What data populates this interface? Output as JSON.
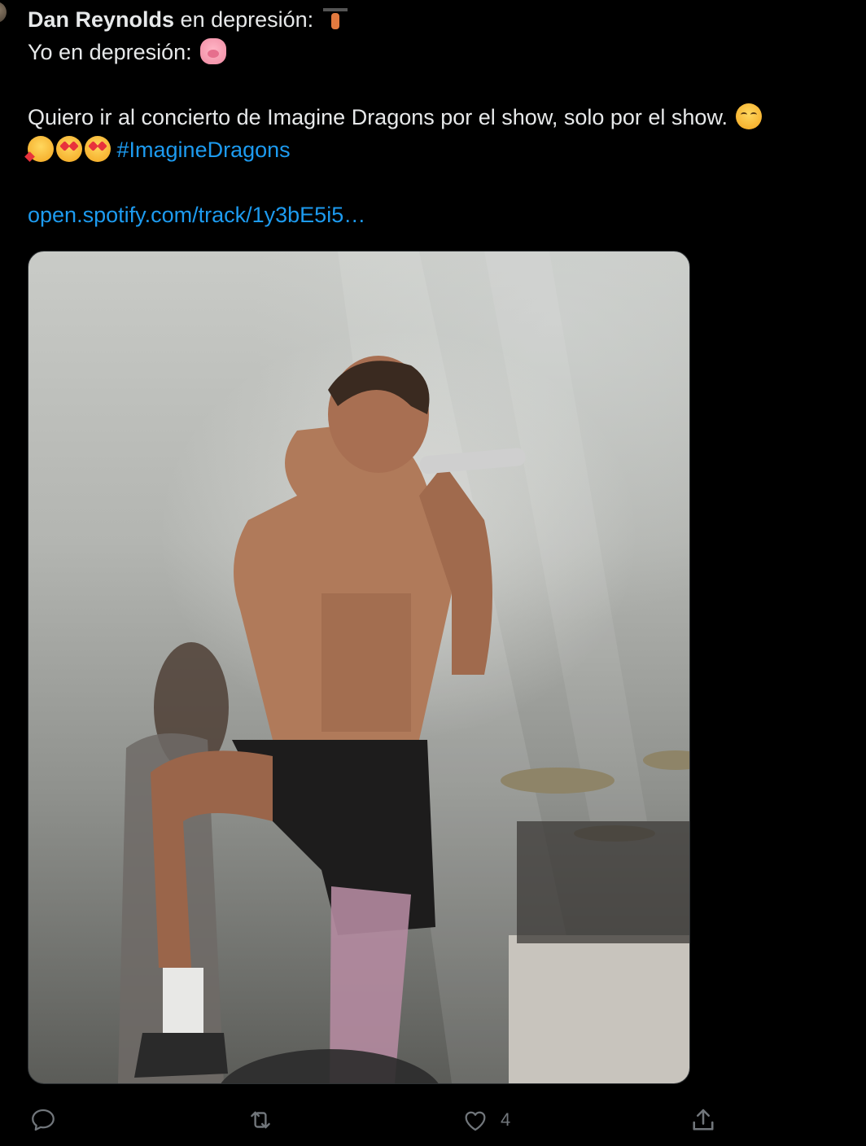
{
  "tweet": {
    "author_name": "Dan Reynolds",
    "line1_suffix": " en depresión:",
    "line2": "Yo en depresión:",
    "line4_text": "Quiero ir al concierto de Imagine Dragons por el show, solo por el show.",
    "hashtag": "#ImagineDragons",
    "link": "open.spotify.com/track/1y3bE5i5…",
    "emojis": {
      "line1": "weight-lifter",
      "line2": "pig-face",
      "line4_end": "drooling-smile",
      "line5": [
        "smiling-face-with-hearts",
        "heart-eyes",
        "heart-eyes"
      ]
    },
    "media": {
      "description_icon": "photo"
    }
  },
  "actions": {
    "reply_icon": "reply-icon",
    "retweet_icon": "retweet-icon",
    "like_icon": "like-icon",
    "like_count": "4",
    "share_icon": "share-icon"
  },
  "colors": {
    "background": "#000000",
    "text": "#e7e9ea",
    "link": "#1d9bf0",
    "muted": "#71767b"
  }
}
